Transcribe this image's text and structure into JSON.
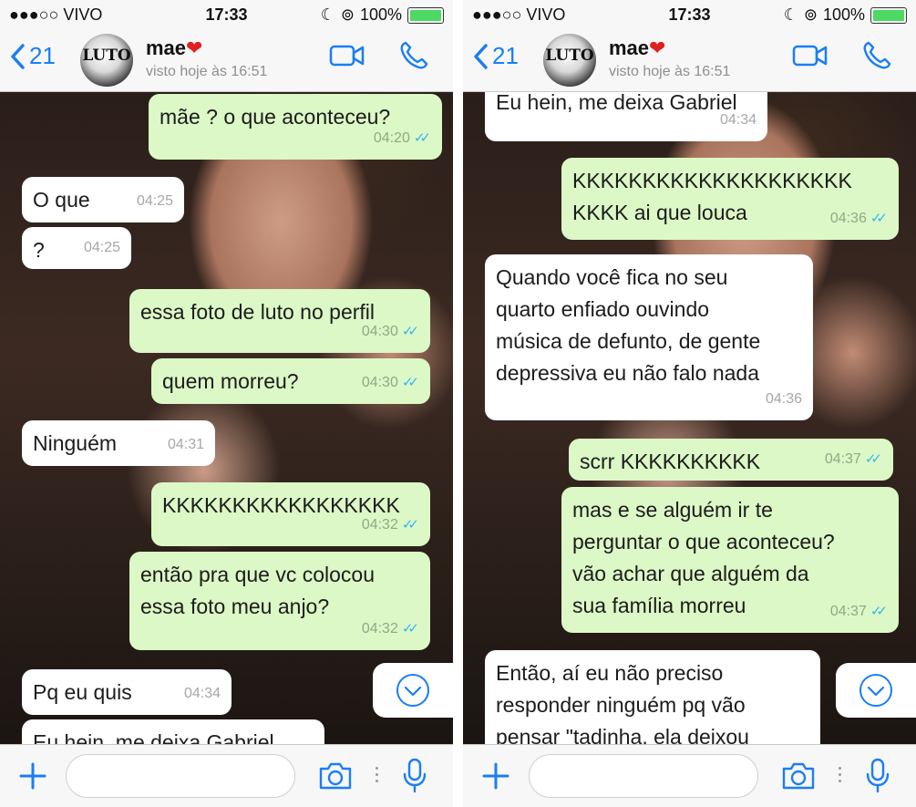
{
  "status_bar": {
    "carrier": "●●●○○ VIVO",
    "time": "17:33",
    "battery": "100%"
  },
  "header": {
    "back_count": "21",
    "avatar_text": "LUTO",
    "contact_name": "mae",
    "contact_emoji": "❤",
    "last_seen": "visto hoje às 16:51"
  },
  "left_messages": [
    {
      "text": "mãe ? o que aconteceu?",
      "time": "04:20"
    },
    {
      "text": "O que",
      "time": "04:25"
    },
    {
      "text": "?",
      "time": "04:25"
    },
    {
      "text": "essa foto de luto no perfil",
      "time": "04:30"
    },
    {
      "text": "quem morreu?",
      "time": "04:30"
    },
    {
      "text": "Ninguém",
      "time": "04:31"
    },
    {
      "text": "KKKKKKKKKKKKKKKKK",
      "time": "04:32"
    },
    {
      "text": "então pra que vc colocou\nessa foto meu anjo?",
      "time": "04:32"
    },
    {
      "text": "Pq eu quis",
      "time": "04:34"
    },
    {
      "text": "Eu hein, me deixa Gabriel",
      "time": ""
    }
  ],
  "right_messages": [
    {
      "text": "Eu hein, me deixa Gabriel",
      "time": "04:34"
    },
    {
      "text": "KKKKKKKKKKKKKKKKKKKK\nKKKK ai que louca",
      "time": "04:36"
    },
    {
      "text": "Quando você fica no seu\nquarto enfiado ouvindo\nmúsica de defunto, de gente\ndepressiva eu não falo nada",
      "time": "04:36"
    },
    {
      "text": "scrr KKKKKKKKKK",
      "time": "04:37"
    },
    {
      "text": "mas e se alguém ir te\nperguntar o que aconteceu?\nvão achar que alguém da\nsua família morreu",
      "time": "04:37"
    },
    {
      "text": "Então, aí eu não preciso\nresponder ninguém pq vão\npensar \"tadinha, ela deixou",
      "time": ""
    }
  ],
  "icons": {
    "back": "chevron-left-icon",
    "video": "video-camera-icon",
    "call": "phone-icon",
    "scroll": "chevron-down-circle-icon",
    "plus": "plus-icon",
    "camera": "camera-icon",
    "mic": "microphone-icon"
  },
  "colors": {
    "accent": "#1a7ef5",
    "outgoing_bubble": "#dcf8c6",
    "incoming_bubble": "#ffffff",
    "read_ticks": "#34b7f1",
    "battery": "#4cd964",
    "heart": "#e02020"
  }
}
